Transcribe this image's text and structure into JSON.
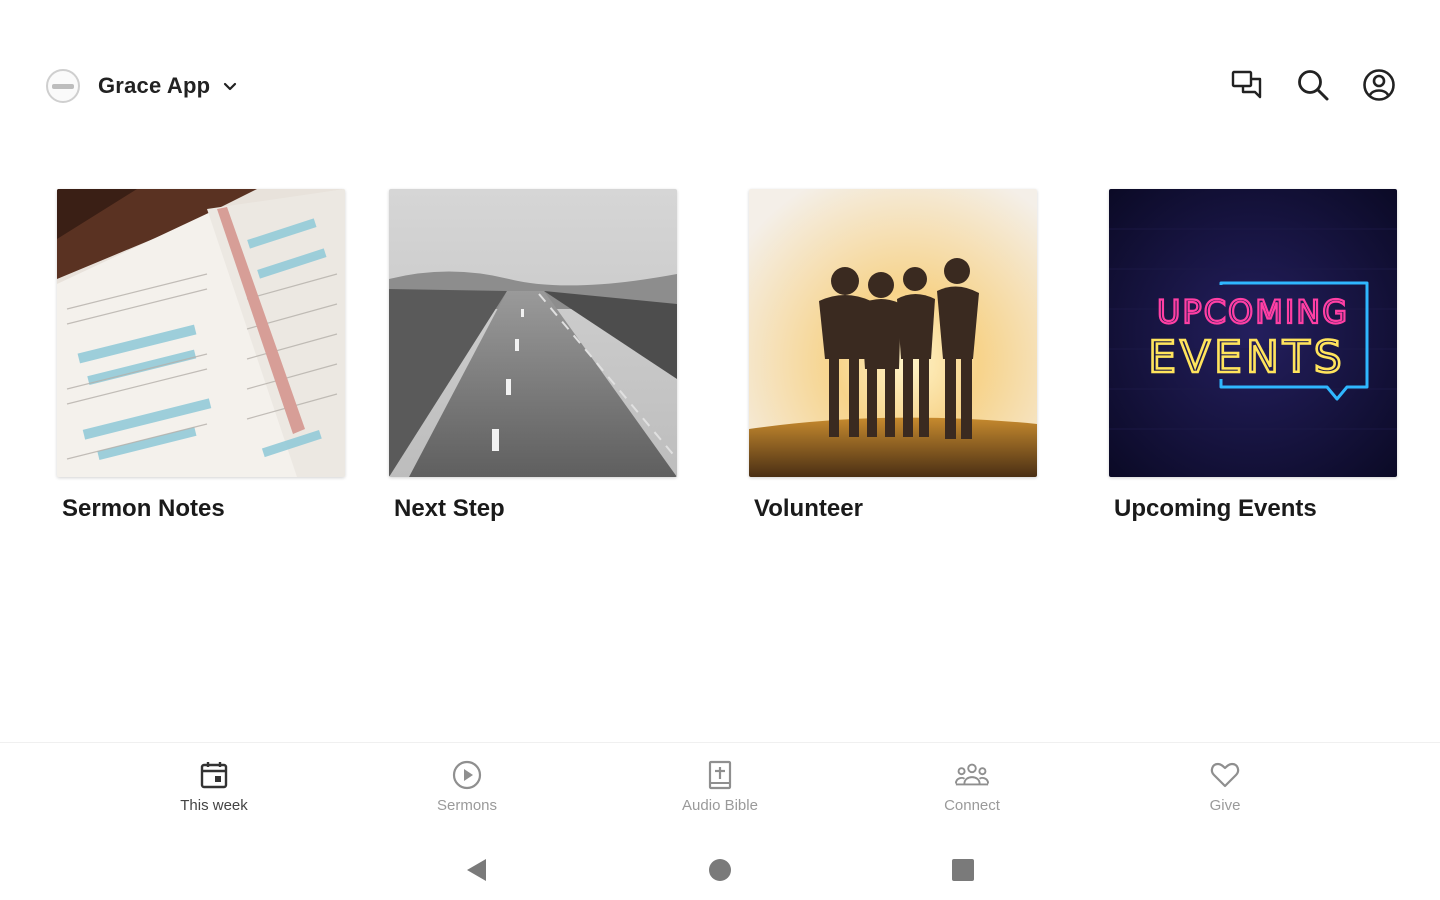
{
  "header": {
    "app_name": "Grace App",
    "icons": {
      "logo": "church-logo-icon",
      "switcher": "chevron-down-icon",
      "messages": "chat-icon",
      "search": "search-icon",
      "account": "account-circle-icon"
    }
  },
  "tiles": [
    {
      "label": "Sermon Notes",
      "image": "open-bible-image"
    },
    {
      "label": "Next Step",
      "image": "road-image"
    },
    {
      "label": "Volunteer",
      "image": "friends-sunset-image"
    },
    {
      "label": "Upcoming Events",
      "image": "neon-sign-image",
      "sign_line1": "UPCOMING",
      "sign_line2": "EVENTS"
    }
  ],
  "bottom_nav": [
    {
      "label": "This week",
      "icon": "calendar-icon",
      "active": true
    },
    {
      "label": "Sermons",
      "icon": "play-circle-icon",
      "active": false
    },
    {
      "label": "Audio Bible",
      "icon": "bible-icon",
      "active": false
    },
    {
      "label": "Connect",
      "icon": "group-icon",
      "active": false
    },
    {
      "label": "Give",
      "icon": "heart-icon",
      "active": false
    }
  ],
  "system_bar": {
    "icons": [
      "back-triangle-icon",
      "home-circle-icon",
      "recents-square-icon"
    ]
  },
  "colors": {
    "neon_pink": "#ff3fa4",
    "neon_yellow": "#ffe45c",
    "neon_blue": "#2fb7ff",
    "nav_inactive": "#9a9a9a"
  }
}
